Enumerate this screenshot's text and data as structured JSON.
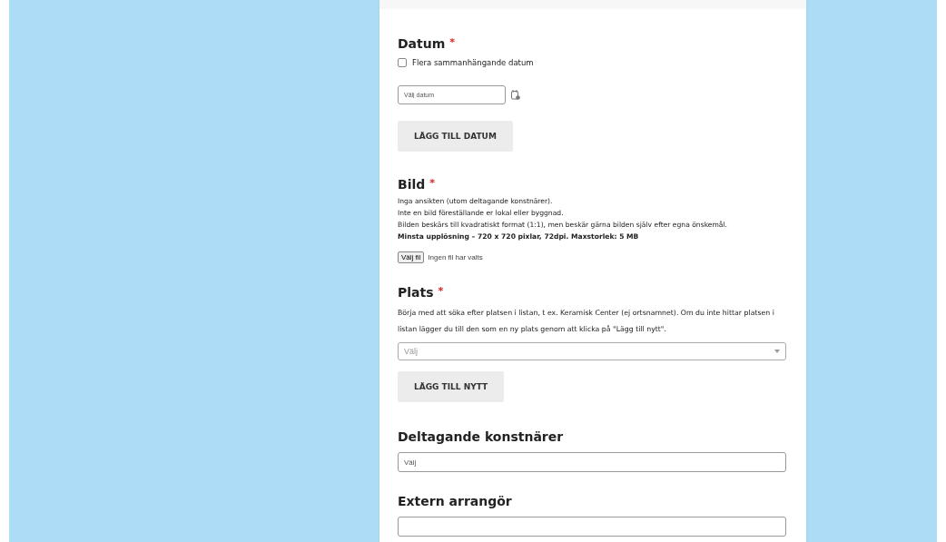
{
  "sections": [
    {
      "kind": "date",
      "title": "Datum",
      "required_mark": "*",
      "checkbox": {
        "label": "Flera sammanhängande datum",
        "checked": false
      },
      "date_field": {
        "placeholder": "Välj datum"
      },
      "button": "LÄGG TILL DATUM"
    },
    {
      "kind": "image",
      "title": "Bild",
      "required_mark": "*",
      "lines": [
        {
          "text": "Inga ansikten (utom deltagande konstnärer).",
          "bold": false
        },
        {
          "text": "Inte en bild föreställande er lokal eller byggnad.",
          "bold": false
        },
        {
          "text": "Bilden beskärs till kvadratiskt format (1:1), men beskär gärna bilden själv efter egna önskemål.",
          "bold": false
        },
        {
          "text": "Minsta upplösning – 720 x 720 pixlar, 72dpi. Maxstorlek: 5 MB",
          "bold": true
        }
      ],
      "file_button": "Välj fil",
      "file_status": "Ingen fil har valts"
    },
    {
      "kind": "place",
      "title": "Plats",
      "required_mark": "*",
      "description": "Börja med att söka efter platsen i listan, t ex. Keramisk Center (ej ortsnamnet). Om du inte hittar platsen i listan lägger du till den som en ny plats genom att klicka på \"Lägg till nytt\".",
      "select": {
        "placeholder": "Välj"
      },
      "button": "LÄGG TILL NYTT"
    },
    {
      "kind": "text",
      "title": "Deltagande konstnärer",
      "field": {
        "placeholder": "Välj"
      }
    },
    {
      "kind": "text",
      "title": "Extern arrangör"
    }
  ]
}
